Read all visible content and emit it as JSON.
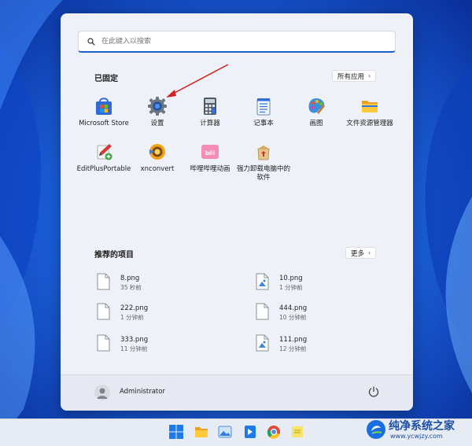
{
  "search": {
    "placeholder": "在此键入以搜索"
  },
  "pinned": {
    "title": "已固定",
    "all_apps_label": "所有应用",
    "apps": [
      {
        "label": "Microsoft Store",
        "icon": "microsoft-store-icon"
      },
      {
        "label": "设置",
        "icon": "settings-gear-icon"
      },
      {
        "label": "计算器",
        "icon": "calculator-icon"
      },
      {
        "label": "记事本",
        "icon": "notepad-icon"
      },
      {
        "label": "画图",
        "icon": "paint-icon"
      },
      {
        "label": "文件资源管理器",
        "icon": "file-explorer-icon"
      },
      {
        "label": "EditPlusPortable",
        "icon": "editplus-icon"
      },
      {
        "label": "xnconvert",
        "icon": "xnconvert-icon"
      },
      {
        "label": "哔哩哔哩动画",
        "icon": "bilibili-icon"
      },
      {
        "label": "强力卸载电脑中的软件",
        "icon": "uninstaller-icon"
      }
    ]
  },
  "recommended": {
    "title": "推荐的项目",
    "more_label": "更多",
    "items": [
      {
        "name": "8.png",
        "time": "35 秒前"
      },
      {
        "name": "10.png",
        "time": "1 分钟前"
      },
      {
        "name": "222.png",
        "time": "1 分钟前"
      },
      {
        "name": "444.png",
        "time": "10 分钟前"
      },
      {
        "name": "333.png",
        "time": "11 分钟前"
      },
      {
        "name": "111.png",
        "time": "12 分钟前"
      }
    ]
  },
  "user": {
    "name": "Administrator"
  },
  "watermark": {
    "title": "纯净系统之家",
    "url": "www.ycwjzy.com"
  },
  "colors": {
    "accent": "#1e5fc9",
    "wallpaper": "#1f6fe6",
    "menu_bg": "#eef1f8",
    "annotation_arrow": "#d42020"
  }
}
